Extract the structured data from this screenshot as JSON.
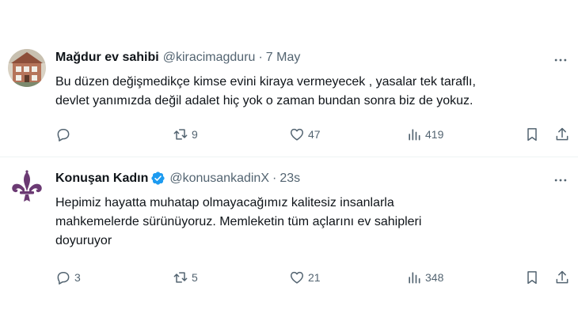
{
  "tweets": [
    {
      "author_name": "Mağdur ev sahibi",
      "handle": "@kiracimagduru",
      "separator": "·",
      "time": "7 May",
      "text_lines": [
        "Bu düzen değişmedikçe kimse evini kiraya vermeyecek , yasalar tek taraflı,",
        "devlet yanımızda değil adalet hiç yok o zaman bundan sonra biz de yokuz."
      ],
      "verified": false,
      "avatar_icon": "house-photo-avatar",
      "replies": "",
      "retweets": "9",
      "likes": "47",
      "views": "419"
    },
    {
      "author_name": "Konuşan Kadın",
      "handle": "@konusankadinX",
      "separator": "·",
      "time": "23s",
      "text_lines": [
        "Hepimiz hayatta muhatap olmayacağımız kalitesiz insanlarla",
        "mahkemelerde sürünüyoruz. Memleketin tüm açlarını ev sahipleri",
        "doyuruyor"
      ],
      "verified": true,
      "avatar_icon": "fleur-de-lis-avatar",
      "replies": "3",
      "retweets": "5",
      "likes": "21",
      "views": "348"
    }
  ],
  "colors": {
    "text": "#0f1419",
    "muted": "#536471",
    "verified": "#1d9bf0",
    "divider": "#eff3f4",
    "fleur": "#6b3a73"
  },
  "icons": [
    "reply-icon",
    "retweet-icon",
    "like-icon",
    "views-icon",
    "bookmark-icon",
    "share-icon",
    "more-icon",
    "verified-badge-icon"
  ]
}
